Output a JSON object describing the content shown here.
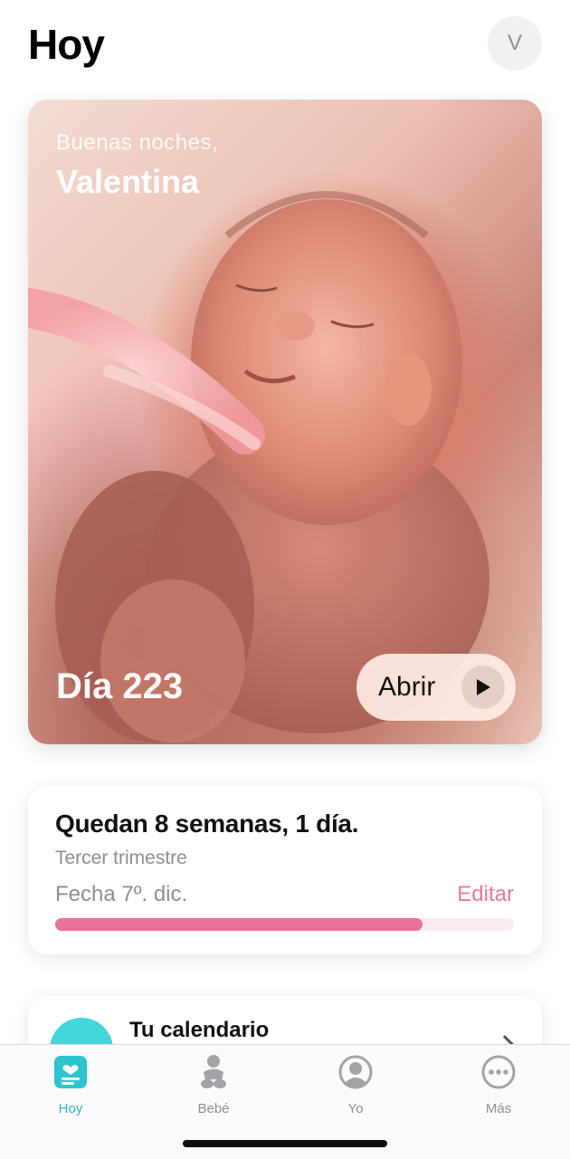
{
  "header": {
    "title": "Hoy",
    "avatar_initial": "V"
  },
  "hero": {
    "greeting": "Buenas noches,",
    "name": "Valentina",
    "day": "Día 223",
    "open_label": "Abrir"
  },
  "pregnancy": {
    "remaining": "Quedan 8 semanas, 1 día.",
    "trimester": "Tercer trimestre",
    "due_date": "Fecha 7º. dic.",
    "edit_label": "Editar",
    "progress_fraction": 0.8
  },
  "calendar": {
    "title": "Tu calendario"
  },
  "tabs": [
    {
      "label": "Hoy",
      "icon": "today-icon",
      "active": true
    },
    {
      "label": "Bebé",
      "icon": "baby-icon",
      "active": false
    },
    {
      "label": "Yo",
      "icon": "profile-icon",
      "active": false
    },
    {
      "label": "Más",
      "icon": "more-icon",
      "active": false
    }
  ],
  "colors": {
    "accent_pink": "#ea7099",
    "accent_teal": "#2bb7c4",
    "calendar_icon": "#43d6da"
  }
}
